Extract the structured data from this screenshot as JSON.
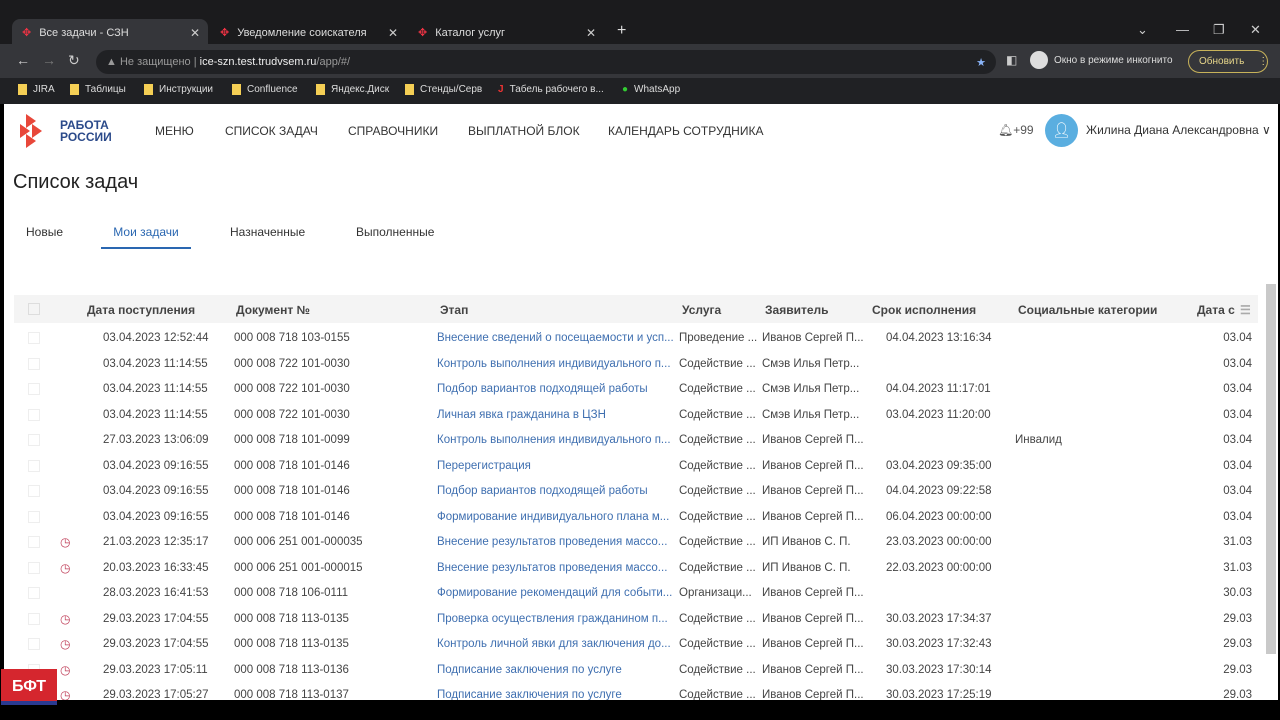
{
  "browser": {
    "tabs": [
      {
        "title": "Все задачи - СЗН"
      },
      {
        "title": "Уведомление соискателя"
      },
      {
        "title": "Каталог услуг"
      }
    ],
    "security": "Не защищено",
    "url_host": "ice-szn.test.trudvsem.ru",
    "url_path": "/app/#/",
    "incognito": "Окно в режиме инкогнито",
    "update": "Обновить",
    "bookmarks": [
      "JIRA",
      "Таблицы",
      "Инструкции",
      "Confluence",
      "Яндекс.Диск",
      "Стенды/Серв",
      "Табель рабочего в...",
      "WhatsApp"
    ]
  },
  "app": {
    "logo_line1": "РАБОТА",
    "logo_line2": "РОССИИ",
    "menu": [
      "МЕНЮ",
      "СПИСОК ЗАДАЧ",
      "СПРАВОЧНИКИ",
      "ВЫПЛАТНОЙ БЛОК",
      "КАЛЕНДАРЬ СОТРУДНИКА"
    ],
    "notifications": "+99",
    "user": "Жилина Диана Александровна",
    "title": "Список задач",
    "tabs": [
      "Новые",
      "Мои задачи",
      "Назначенные",
      "Выполненные"
    ],
    "columns": [
      "Дата поступления",
      "Документ №",
      "Этап",
      "Услуга",
      "Заявитель",
      "Срок исполнения",
      "Социальные категории",
      "Дата с"
    ],
    "rows": [
      {
        "clock": false,
        "date": "03.04.2023 12:52:44",
        "doc": "000 008 718 103-0155",
        "stage": "Внесение сведений о посещаемости и усп...",
        "service": "Проведение ...",
        "applicant": "Иванов Сергей П...",
        "due": "04.04.2023 13:16:34",
        "social": "",
        "date_s": "03.04"
      },
      {
        "clock": false,
        "date": "03.04.2023 11:14:55",
        "doc": "000 008 722 101-0030",
        "stage": "Контроль выполнения индивидуального п...",
        "service": "Содействие ...",
        "applicant": "Смэв Илья Петр...",
        "due": "",
        "social": "",
        "date_s": "03.04"
      },
      {
        "clock": false,
        "date": "03.04.2023 11:14:55",
        "doc": "000 008 722 101-0030",
        "stage": "Подбор вариантов подходящей работы",
        "service": "Содействие ...",
        "applicant": "Смэв Илья Петр...",
        "due": "04.04.2023 11:17:01",
        "social": "",
        "date_s": "03.04"
      },
      {
        "clock": false,
        "date": "03.04.2023 11:14:55",
        "doc": "000 008 722 101-0030",
        "stage": "Личная явка гражданина в ЦЗН",
        "service": "Содействие ...",
        "applicant": "Смэв Илья Петр...",
        "due": "03.04.2023 11:20:00",
        "social": "",
        "date_s": "03.04"
      },
      {
        "clock": false,
        "date": "27.03.2023 13:06:09",
        "doc": "000 008 718 101-0099",
        "stage": "Контроль выполнения индивидуального п...",
        "service": "Содействие ...",
        "applicant": "Иванов Сергей П...",
        "due": "",
        "social": "Инвалид",
        "date_s": "03.04"
      },
      {
        "clock": false,
        "date": "03.04.2023 09:16:55",
        "doc": "000 008 718 101-0146",
        "stage": "Перерегистрация",
        "service": "Содействие ...",
        "applicant": "Иванов Сергей П...",
        "due": "03.04.2023 09:35:00",
        "social": "",
        "date_s": "03.04"
      },
      {
        "clock": false,
        "date": "03.04.2023 09:16:55",
        "doc": "000 008 718 101-0146",
        "stage": "Подбор вариантов подходящей работы",
        "service": "Содействие ...",
        "applicant": "Иванов Сергей П...",
        "due": "04.04.2023 09:22:58",
        "social": "",
        "date_s": "03.04"
      },
      {
        "clock": false,
        "date": "03.04.2023 09:16:55",
        "doc": "000 008 718 101-0146",
        "stage": "Формирование индивидуального плана м...",
        "service": "Содействие ...",
        "applicant": "Иванов Сергей П...",
        "due": "06.04.2023 00:00:00",
        "social": "",
        "date_s": "03.04"
      },
      {
        "clock": true,
        "date": "21.03.2023 12:35:17",
        "doc": "000 006 251 001-000035",
        "stage": "Внесение результатов проведения массо...",
        "service": "Содействие ...",
        "applicant": "ИП Иванов С. П.",
        "due": "23.03.2023 00:00:00",
        "social": "",
        "date_s": "31.03"
      },
      {
        "clock": true,
        "date": "20.03.2023 16:33:45",
        "doc": "000 006 251 001-000015",
        "stage": "Внесение результатов проведения массо...",
        "service": "Содействие ...",
        "applicant": "ИП Иванов С. П.",
        "due": "22.03.2023 00:00:00",
        "social": "",
        "date_s": "31.03"
      },
      {
        "clock": false,
        "date": "28.03.2023 16:41:53",
        "doc": "000 008 718 106-0111",
        "stage": "Формирование рекомендаций для событи...",
        "service": "Организаци...",
        "applicant": "Иванов Сергей П...",
        "due": "",
        "social": "",
        "date_s": "30.03"
      },
      {
        "clock": true,
        "date": "29.03.2023 17:04:55",
        "doc": "000 008 718 113-0135",
        "stage": "Проверка осуществления гражданином п...",
        "service": "Содействие ...",
        "applicant": "Иванов Сергей П...",
        "due": "30.03.2023 17:34:37",
        "social": "",
        "date_s": "29.03"
      },
      {
        "clock": true,
        "date": "29.03.2023 17:04:55",
        "doc": "000 008 718 113-0135",
        "stage": "Контроль личной явки для заключения до...",
        "service": "Содействие ...",
        "applicant": "Иванов Сергей П...",
        "due": "30.03.2023 17:32:43",
        "social": "",
        "date_s": "29.03"
      },
      {
        "clock": true,
        "date": "29.03.2023 17:05:11",
        "doc": "000 008 718 113-0136",
        "stage": "Подписание заключения по услуге",
        "service": "Содействие ...",
        "applicant": "Иванов Сергей П...",
        "due": "30.03.2023 17:30:14",
        "social": "",
        "date_s": "29.03"
      },
      {
        "clock": true,
        "date": "29.03.2023 17:05:27",
        "doc": "000 008 718 113-0137",
        "stage": "Подписание заключения по услуге",
        "service": "Содействие ...",
        "applicant": "Иванов Сергей П...",
        "due": "30.03.2023 17:25:19",
        "social": "",
        "date_s": "29.03"
      }
    ],
    "badge": "БФТ"
  }
}
